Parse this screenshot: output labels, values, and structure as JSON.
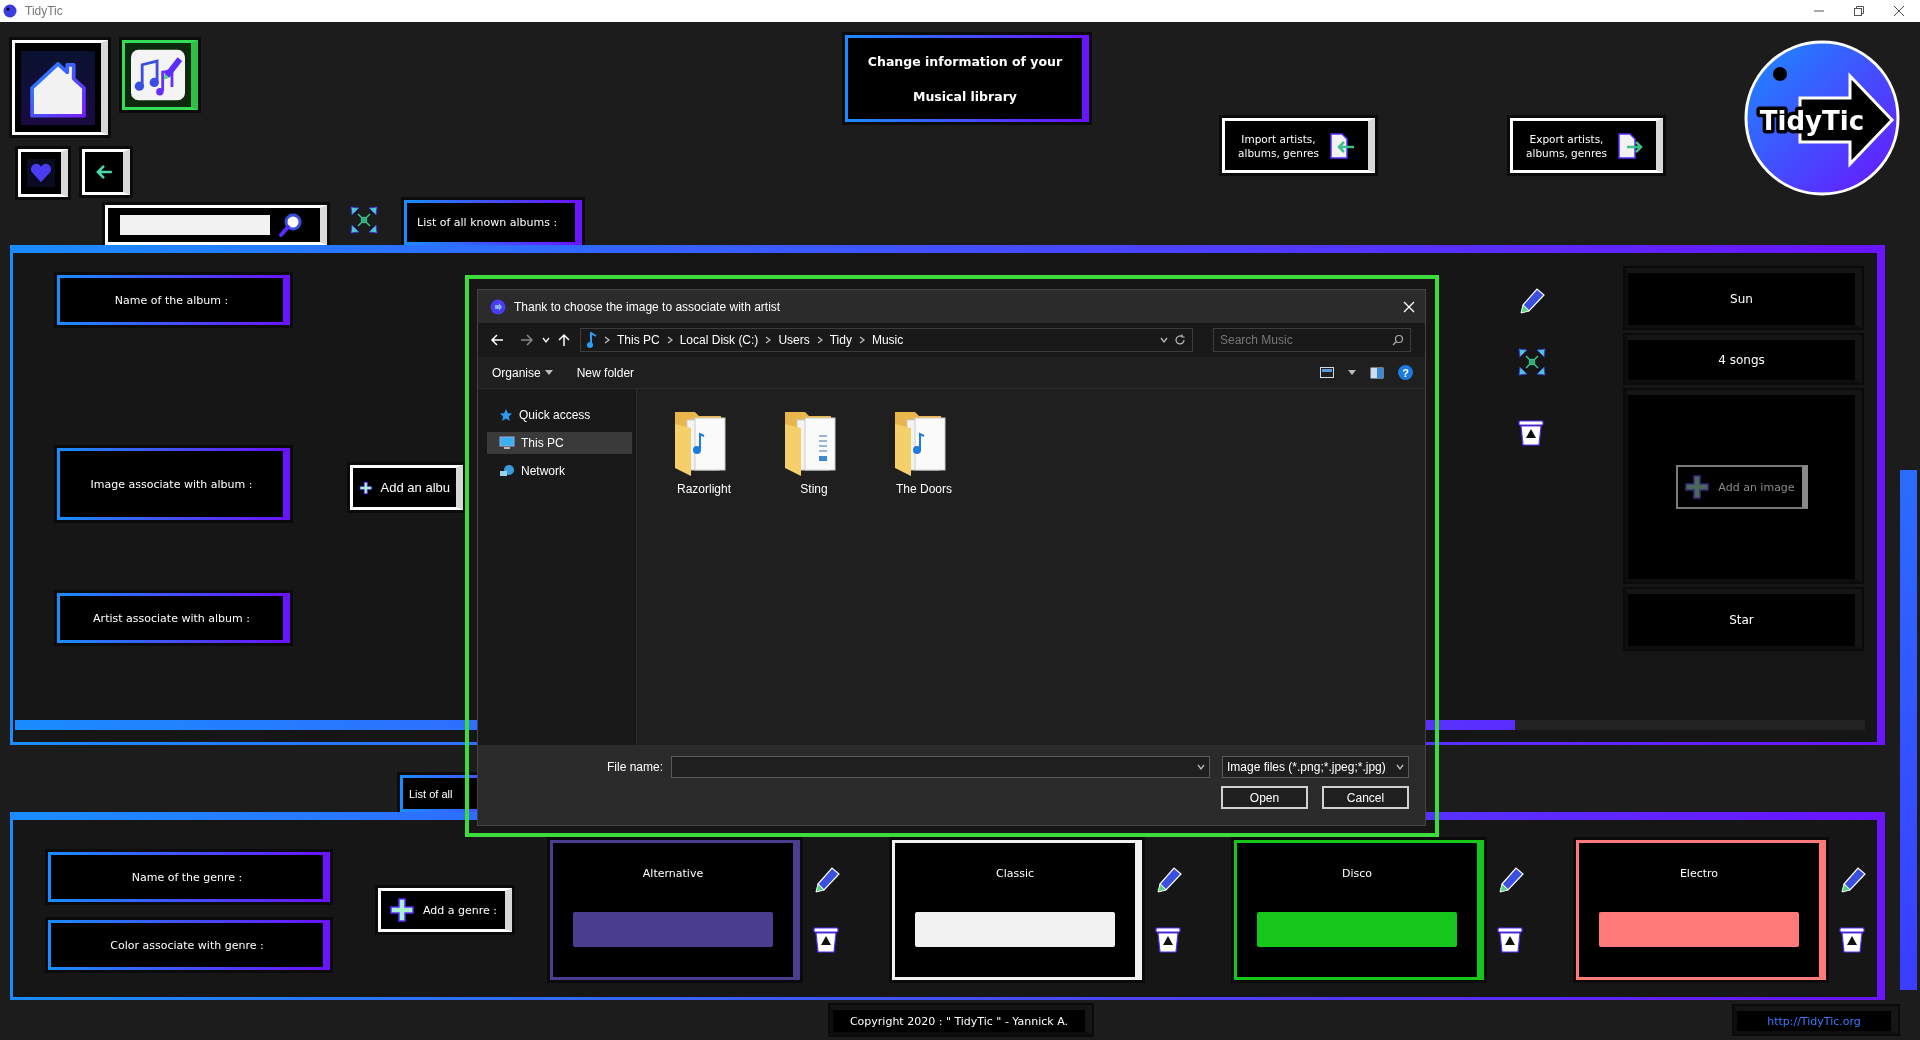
{
  "window": {
    "title": "TidyTic"
  },
  "header": {
    "lines": [
      "Change information of your",
      "Musical library"
    ]
  },
  "import_button": {
    "lines": [
      "Import artists,",
      "albums, genres"
    ]
  },
  "export_button": {
    "lines": [
      "Export artists,",
      "albums, genres"
    ]
  },
  "logo": {
    "text": "TidyTic"
  },
  "albums": {
    "tab": "List of all known albums :",
    "labels": [
      "Name of the album :",
      "Image associate with album :",
      "Artist associate with album :"
    ],
    "add_button": "Add an albu",
    "details": {
      "name": "Sun",
      "songs": "4 songs",
      "add_image_button": {
        "label": "Add an image",
        "disabled": true
      },
      "artist": "Star"
    }
  },
  "genres": {
    "tab": "List of all",
    "labels": [
      "Name of the genre :",
      "Color associate with genre :"
    ],
    "add_button": "Add a genre :",
    "items": [
      {
        "name": "Alternative",
        "color": "#4b3d8f"
      },
      {
        "name": "Classic",
        "color": "#f2f2f2"
      },
      {
        "name": "Disco",
        "color": "#16c71a"
      },
      {
        "name": "Electro",
        "color": "#ff7a78"
      }
    ]
  },
  "footer": {
    "copyright": "Copyright 2020 : \" TidyTic \" - Yannick A.",
    "link": "http://TidyTic.org"
  },
  "dialog": {
    "title": "Thank to choose the image to associate with artist",
    "breadcrumb": [
      "This PC",
      "Local Disk (C:)",
      "Users",
      "Tidy",
      "Music"
    ],
    "search_placeholder": "Search Music",
    "commands": [
      "Organise",
      "New folder"
    ],
    "help": "?",
    "nav_items": [
      {
        "label": "Quick access",
        "kind": "pinned",
        "selected": false
      },
      {
        "label": "This PC",
        "kind": "computer",
        "selected": true
      },
      {
        "label": "Network",
        "kind": "network",
        "selected": false
      }
    ],
    "folders": [
      {
        "name": "Razorlight",
        "kind": "music"
      },
      {
        "name": "Sting",
        "kind": "documents"
      },
      {
        "name": "The Doors",
        "kind": "music"
      }
    ],
    "file_name_label": "File name:",
    "file_type": "Image files (*.png;*.jpeg;*.jpg)",
    "buttons": [
      "Open",
      "Cancel"
    ]
  }
}
